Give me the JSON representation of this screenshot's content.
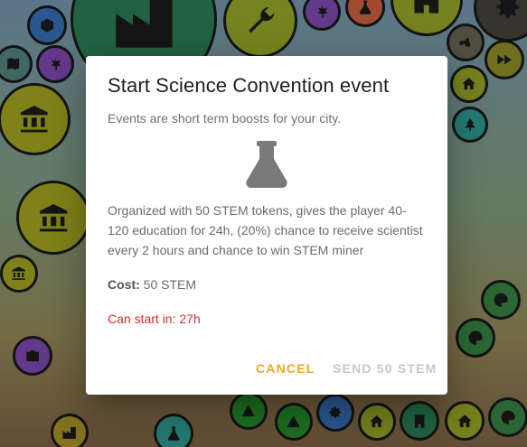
{
  "dialog": {
    "title": "Start Science Convention event",
    "subtitle": "Events are short term boosts for your city.",
    "icon": "flask-icon",
    "description": "Organized with 50 STEM tokens, gives the player 40-120 education for 24h, (20%) chance to receive scientist every 2 hours and chance to win STEM miner",
    "cost_label": "Cost:",
    "cost_value": "50 STEM",
    "timer_text": "Can start in: 27h",
    "cancel_label": "CANCEL",
    "send_label": "SEND 50 STEM",
    "colors": {
      "accent": "#f0a42a",
      "warning": "#d32f2f",
      "disabled": "#c7c7c7"
    }
  },
  "background_bubbles": [
    {
      "icon": "factory-icon",
      "color": "#2f8a5a"
    },
    {
      "icon": "wrench-icon",
      "color": "#8fae2a"
    },
    {
      "icon": "leaf-icon",
      "color": "#8a4fc2"
    },
    {
      "icon": "flask-icon",
      "color": "#e06a44"
    },
    {
      "icon": "building-icon",
      "color": "#a2b52b"
    },
    {
      "icon": "gear-icon",
      "color": "#3d3d3d"
    },
    {
      "icon": "cube-icon",
      "color": "#3c79c8"
    },
    {
      "icon": "tractor-icon",
      "color": "#6e6c5a"
    },
    {
      "icon": "bank-icon",
      "color": "#b2b523"
    },
    {
      "icon": "map-icon",
      "color": "#5b8f88"
    },
    {
      "icon": "tree-icon",
      "color": "#34a9a0"
    },
    {
      "icon": "fast-forward-icon",
      "color": "#9a9a2a"
    },
    {
      "icon": "home-icon",
      "color": "#a3b42a"
    },
    {
      "icon": "palette-icon",
      "color": "#3c8f4a"
    },
    {
      "icon": "tent-icon",
      "color": "#2a9a2f"
    }
  ]
}
